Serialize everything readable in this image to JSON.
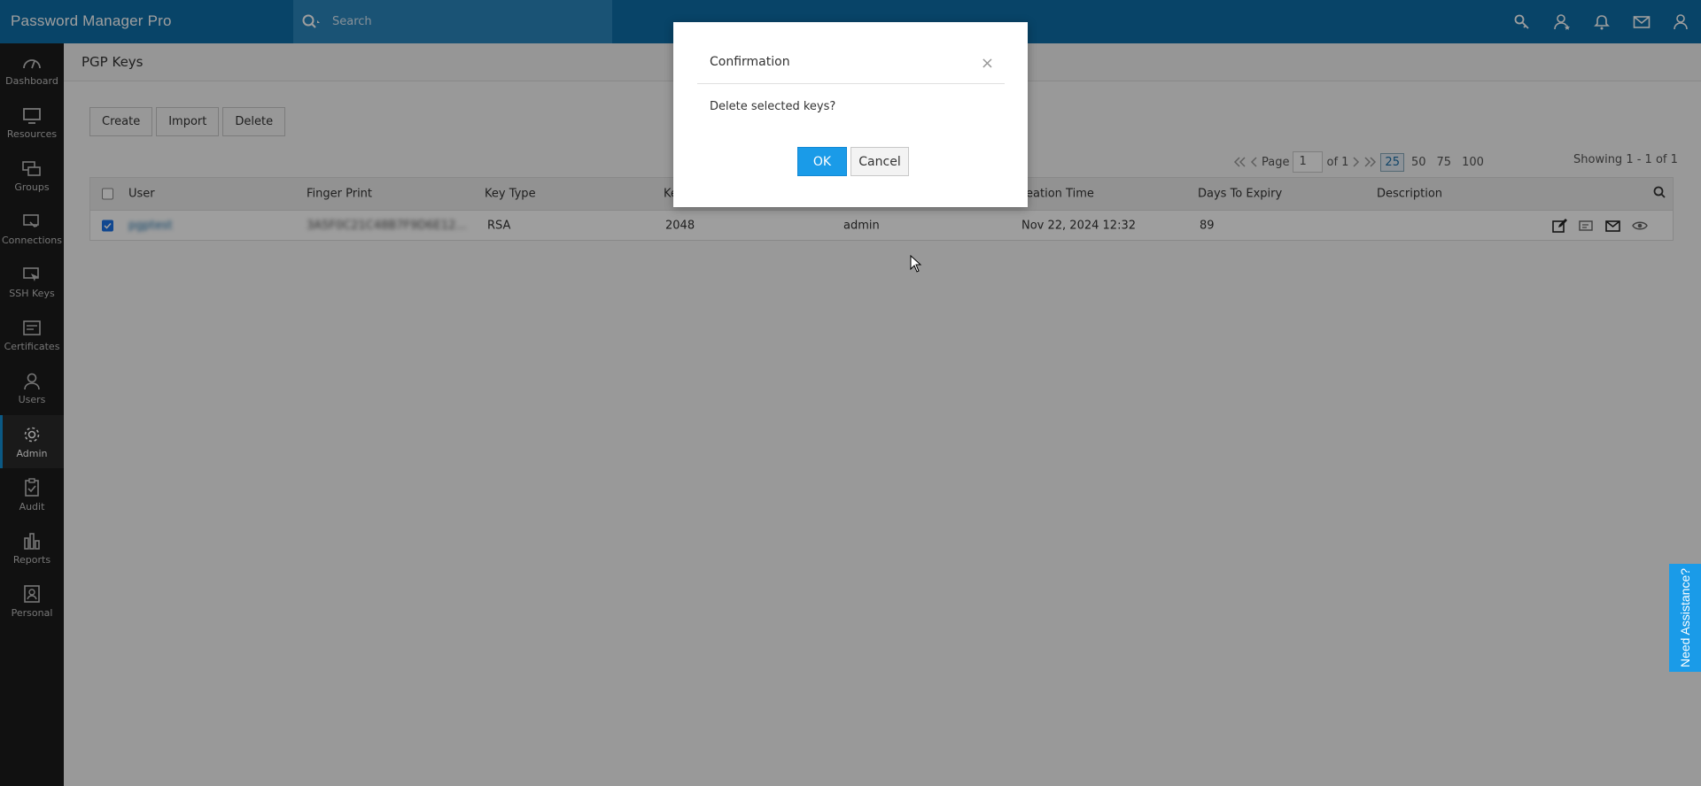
{
  "app": {
    "title": "Password Manager Pro"
  },
  "search": {
    "placeholder": "Search"
  },
  "sidebar": {
    "items": [
      {
        "label": "Dashboard"
      },
      {
        "label": "Resources"
      },
      {
        "label": "Groups"
      },
      {
        "label": "Connections"
      },
      {
        "label": "SSH Keys"
      },
      {
        "label": "Certificates"
      },
      {
        "label": "Users"
      },
      {
        "label": "Admin"
      },
      {
        "label": "Audit"
      },
      {
        "label": "Reports"
      },
      {
        "label": "Personal"
      }
    ],
    "active": "Admin"
  },
  "page": {
    "title": "PGP Keys"
  },
  "toolbar": {
    "create": "Create",
    "import": "Import",
    "delete": "Delete"
  },
  "pager": {
    "page_label": "Page",
    "page_value": "1",
    "of_label": "of 1",
    "sizes": [
      "25",
      "50",
      "75",
      "100"
    ],
    "selected_size": "25",
    "showing": "Showing 1 - 1 of 1"
  },
  "table": {
    "headers": {
      "user": "User",
      "fingerprint": "Finger Print",
      "key_type": "Key Type",
      "key_size": "Ke",
      "owner": "",
      "creation_time": "reation Time",
      "days_to_expiry": "Days To Expiry",
      "description": "Description"
    },
    "rows": [
      {
        "user": "pgptest",
        "fingerprint": "3A5F0C21C48B7F9D6E12...",
        "key_type": "RSA",
        "key_size": "2048",
        "owner": "admin",
        "creation_time": "Nov 22, 2024 12:32",
        "days_to_expiry": "89",
        "description": ""
      }
    ]
  },
  "modal": {
    "title": "Confirmation",
    "close": "×",
    "message": "Delete selected keys?",
    "ok": "OK",
    "cancel": "Cancel"
  },
  "assist": {
    "label": "Need Assistance?"
  },
  "colors": {
    "topbar": "#0d6ea8",
    "sidebar": "#1c1c1c",
    "accent": "#1a9be8"
  }
}
